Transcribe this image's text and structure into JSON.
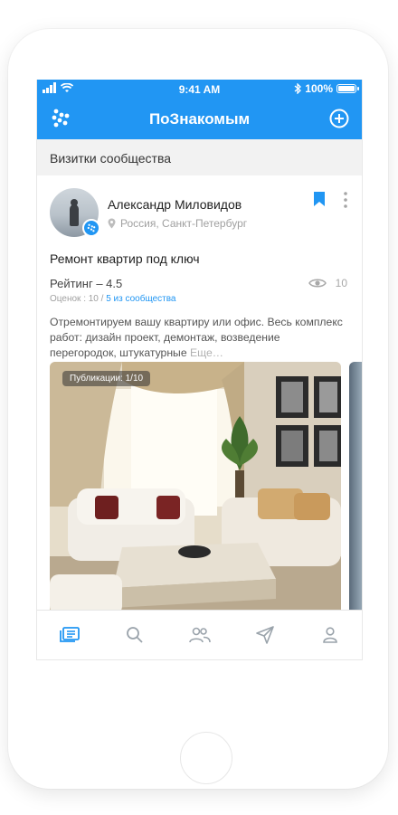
{
  "status_bar": {
    "time": "9:41 AM",
    "battery": "100%",
    "icons": [
      "signal-icon",
      "wifi-icon",
      "bluetooth-icon",
      "battery-icon"
    ]
  },
  "navbar": {
    "title": "ПоЗнакомым",
    "left_icon": "app-logo-icon",
    "right_icon": "add-circle-icon"
  },
  "section": {
    "title": "Визитки сообщества"
  },
  "card": {
    "name": "Александр Миловидов",
    "location": "Россия, Санкт-Петербург",
    "title": "Ремонт квартир под ключ",
    "rating": "Рейтинг – 4.5",
    "ratings_prefix": "Оценок : 10 /",
    "ratings_link": "5 из сообщества",
    "views": "10",
    "description": "Отремонтируем вашу квартиру или офис. Весь комплекс работ: дизайн проект, демонтаж, возведение перегородок, штукатурные",
    "more_label": "Еще…",
    "publications_badge": "Публикации: 1/10"
  },
  "tabbar": {
    "items": [
      {
        "icon": "cards-icon",
        "active": true
      },
      {
        "icon": "search-icon",
        "active": false
      },
      {
        "icon": "people-icon",
        "active": false
      },
      {
        "icon": "send-icon",
        "active": false
      },
      {
        "icon": "profile-icon",
        "active": false
      }
    ]
  },
  "colors": {
    "accent": "#2196f3",
    "icon_inactive": "#9aa3ab",
    "section_bg": "#f2f2f2"
  }
}
